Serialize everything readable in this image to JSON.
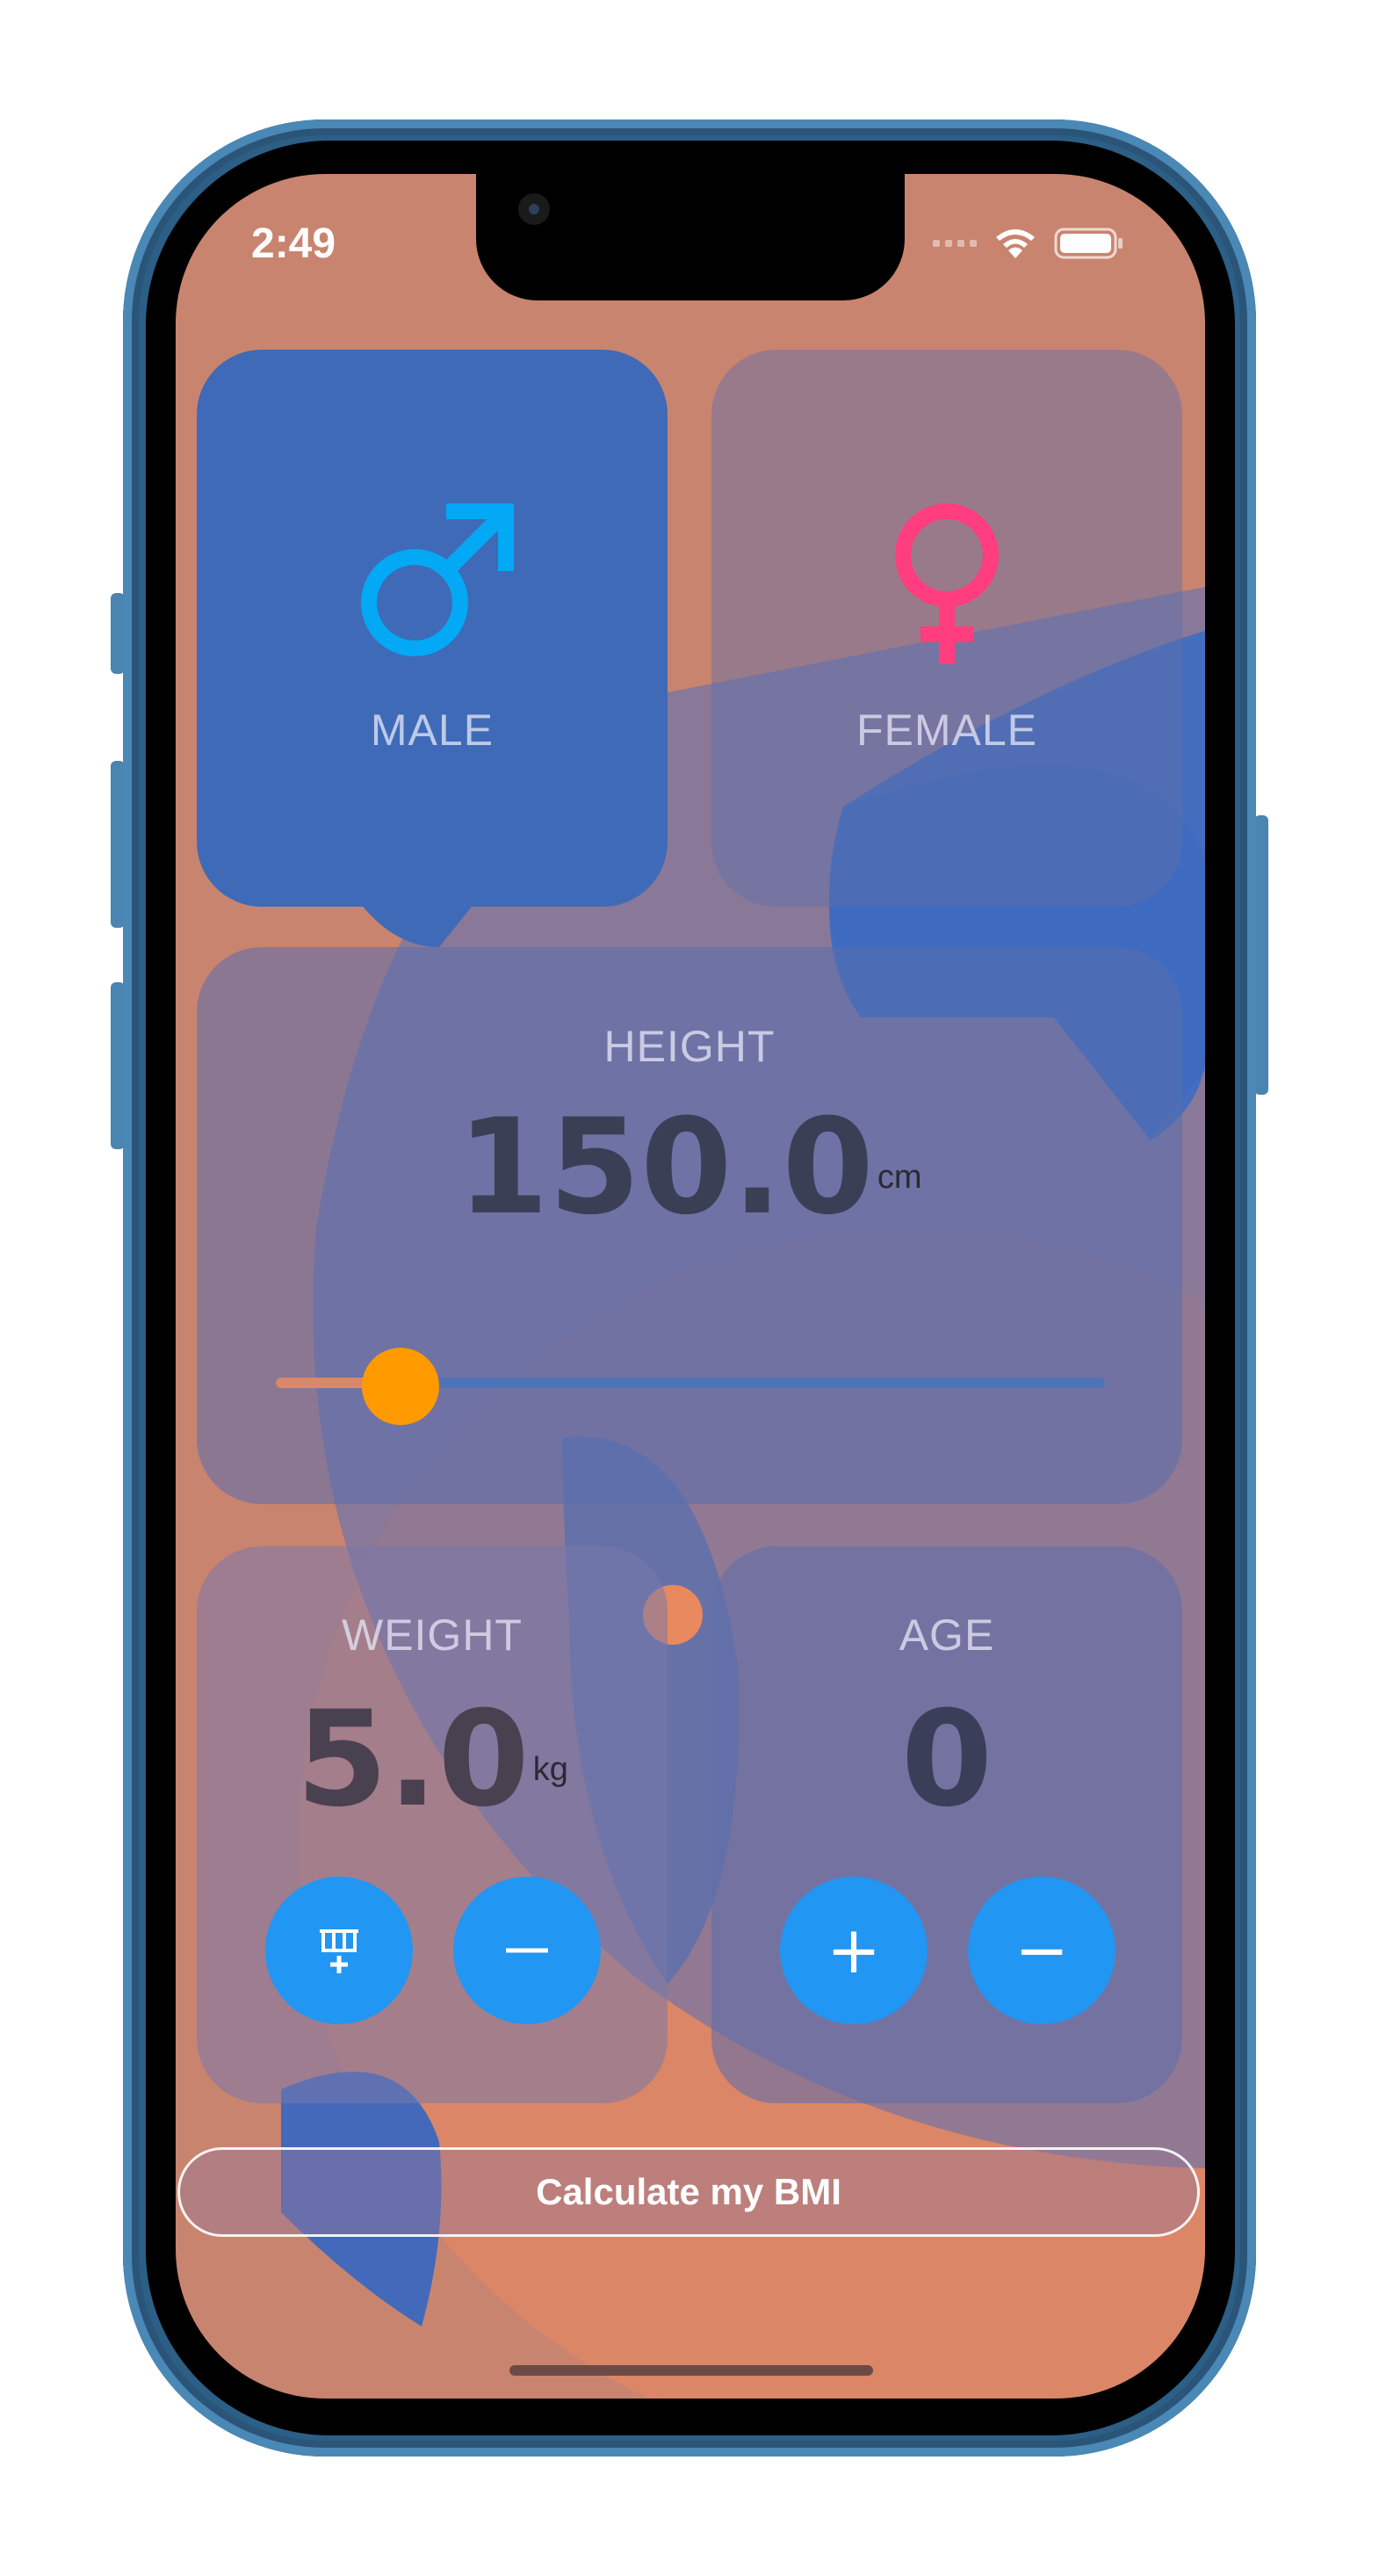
{
  "status_bar": {
    "time": "2:49"
  },
  "gender": {
    "male_label": "MALE",
    "female_label": "FEMALE",
    "male_icon": "male-symbol",
    "female_icon": "female-symbol",
    "selected": "MALE"
  },
  "height": {
    "label": "HEIGHT",
    "value": "150.0",
    "unit": "cm",
    "slider_fraction": 0.15
  },
  "weight": {
    "label": "WEIGHT",
    "value": "5.0",
    "unit": "kg",
    "buttons": [
      "plus-icon",
      "minus-icon"
    ]
  },
  "age": {
    "label": "AGE",
    "value": "0",
    "plus_label": "+",
    "minus_label": "−"
  },
  "calculate_button": {
    "label": "Calculate my BMI"
  },
  "colors": {
    "male_icon": "#03a9f4",
    "female_icon": "#ff3d7f",
    "slider_thumb": "#ff9a00",
    "round_button": "#2196f3"
  }
}
